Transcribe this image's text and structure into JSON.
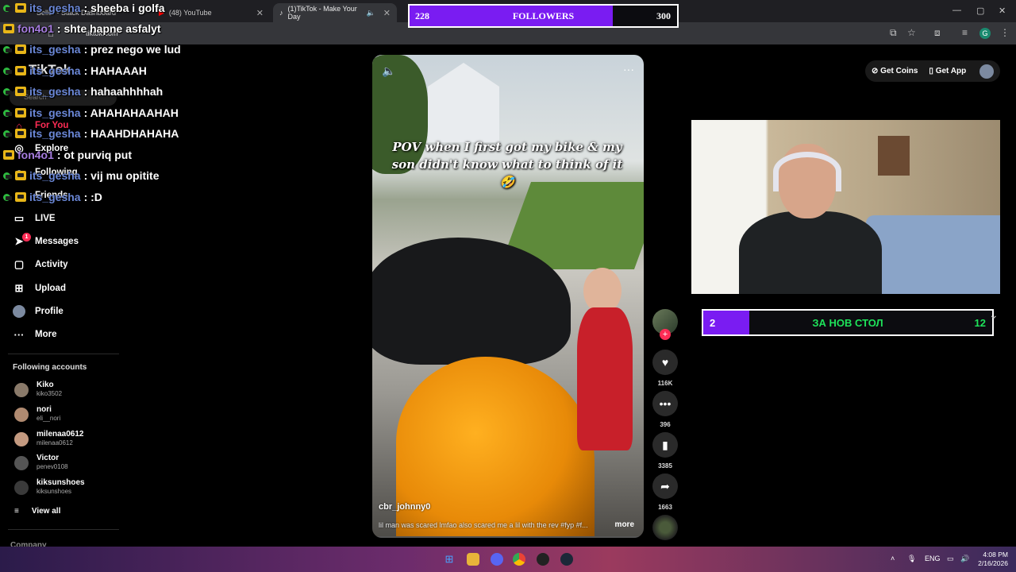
{
  "browser": {
    "tabs": [
      {
        "label": "Seller - Stack Dashboard"
      },
      {
        "label": "(48) YouTube"
      },
      {
        "label": "(1)TikTok - Make Your Day"
      }
    ],
    "url": "tiktok.com",
    "profile_letter": "G"
  },
  "followers_goal": {
    "current": "228",
    "label": "FOLLOWERS",
    "target": "300",
    "progress": 0.76,
    "color": "#7a1cf2"
  },
  "tiktok": {
    "logo": "TikTok",
    "search_placeholder": "Search",
    "nav": [
      {
        "label": "For You",
        "icon": "home-icon"
      },
      {
        "label": "Explore",
        "icon": "compass-icon"
      },
      {
        "label": "Following",
        "icon": "people-icon"
      },
      {
        "label": "Friends",
        "icon": "friends-icon"
      },
      {
        "label": "LIVE",
        "icon": "live-icon"
      },
      {
        "label": "Messages",
        "icon": "message-icon",
        "badge": "1"
      },
      {
        "label": "Activity",
        "icon": "activity-icon"
      },
      {
        "label": "Upload",
        "icon": "upload-icon"
      },
      {
        "label": "Profile",
        "icon": "profile-icon"
      },
      {
        "label": "More",
        "icon": "more-icon"
      }
    ],
    "following_header": "Following accounts",
    "accounts": [
      {
        "name": "Kiko",
        "handle": "kiko3502"
      },
      {
        "name": "nori",
        "handle": "eli__nori"
      },
      {
        "name": "milenaa0612",
        "handle": "milenaa0612"
      },
      {
        "name": "Victor",
        "handle": "penev0108"
      },
      {
        "name": "kiksunshoes",
        "handle": "kiksunshoes"
      }
    ],
    "view_all": "View all",
    "company": "Company",
    "header_right": {
      "get_coins": "Get Coins",
      "get_app": "Get App"
    }
  },
  "chat": [
    {
      "user": "its_gesha",
      "message": ": sheeba i golfa",
      "badge": "crown"
    },
    {
      "user": "fon4o1",
      "message": ": shte hapne asfalyt",
      "badge": "crown",
      "user_color": "purple"
    },
    {
      "user": "its_gesha",
      "message": ": prez nego we lud",
      "badge": "crown"
    },
    {
      "user": "its_gesha",
      "message": ": HAHAAAH",
      "badge": "crown"
    },
    {
      "user": "its_gesha",
      "message": ": hahaahhhhah",
      "badge": "crown"
    },
    {
      "user": "its_gesha",
      "message": ": AHAHAHAAHAH",
      "badge": "crown"
    },
    {
      "user": "its_gesha",
      "message": ": HAAHDHAHAHA",
      "badge": "crown"
    },
    {
      "user": "fon4o1",
      "message": ": ot purviq put",
      "badge": "crown",
      "user_color": "purple"
    },
    {
      "user": "its_gesha",
      "message": ": vij mu opitite",
      "badge": "crown"
    },
    {
      "user": "its_gesha",
      "message": ": :D",
      "badge": "crown"
    }
  ],
  "video": {
    "caption": "POV when I first got my bike & my son didn't know what to think of it 🤣",
    "username": "cbr_johnny0",
    "description": "lil man was scared lmfao also scared me a lil with the rev #fyp #f...",
    "more": "more",
    "likes": "116K",
    "comments": "396",
    "saves": "3385",
    "shares": "1663"
  },
  "table_goal": {
    "current": "2",
    "label": "ЗА НОВ СТОЛ",
    "target": "12",
    "progress": 0.16,
    "color": "#7a1cf2"
  },
  "taskbar": {
    "lang": "ENG",
    "time": "4:08 PM",
    "date": "2/16/2026"
  }
}
